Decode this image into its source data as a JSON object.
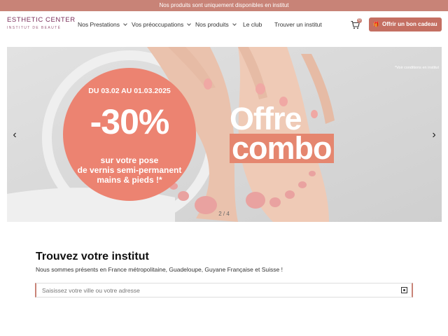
{
  "topbar": {
    "text": "Nos produits sont uniquement disponibles en institut"
  },
  "logo": {
    "brand": "ESTHETIC CENTER",
    "subtitle": "INSTITUT DE BEAUTÉ"
  },
  "nav": {
    "items": [
      {
        "label": "Nos Prestations",
        "has_dropdown": true
      },
      {
        "label": "Vos préoccupations",
        "has_dropdown": true
      },
      {
        "label": "Nos produits",
        "has_dropdown": true
      },
      {
        "label": "Le club",
        "has_dropdown": false
      },
      {
        "label": "Trouver un institut",
        "has_dropdown": false
      }
    ]
  },
  "cart": {
    "icon": "cart-icon",
    "count": "0"
  },
  "gift_button": {
    "icon": "gift-icon",
    "label": "Offrir un bon cadeau"
  },
  "hero": {
    "date": "DU 03.02 AU 01.03.2025",
    "discount": "-30%",
    "line1": "sur votre pose",
    "line2": "de vernis semi-permanent",
    "line3": "mains & pieds !*",
    "offer_line1": "Offre",
    "offer_line2": "combo",
    "conditions": "*Voir conditions en institut",
    "pager": "2 / 4",
    "prev_icon": "chevron-left-icon",
    "next_icon": "chevron-right-icon"
  },
  "finder": {
    "title": "Trouvez votre institut",
    "description": "Nous sommes présents en France métropolitaine, Guadeloupe, Guyane Française et Suisse !",
    "search_placeholder": "Saisissez votre ville ou votre adresse",
    "search_value": "",
    "locate_icon": "locate-icon"
  },
  "colors": {
    "brand": "#c88377",
    "button": "#c46f62",
    "promo_disk": "#ec8371"
  }
}
